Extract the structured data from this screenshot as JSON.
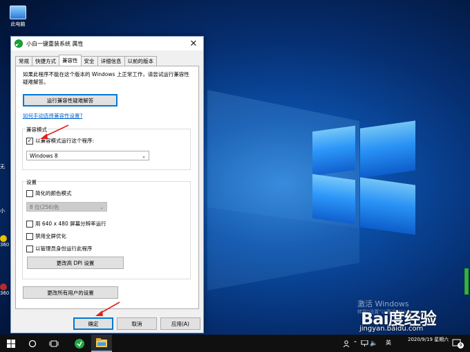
{
  "desktop": {
    "icons": [
      {
        "label": "此电脑"
      }
    ],
    "edge_labels": [
      "无",
      "小",
      "360",
      "360"
    ],
    "watermark": {
      "line1": "激活 Windows",
      "line2": "转到\"设置\"以激活 Windows。"
    },
    "baidu": {
      "logo": "Bai度经验",
      "url": "jingyan.baidu.com"
    }
  },
  "dialog": {
    "title": "小白一键重装系统 属性",
    "close_glyph": "✕",
    "tabs": [
      {
        "label": "常规"
      },
      {
        "label": "快捷方式"
      },
      {
        "label": "兼容性"
      },
      {
        "label": "安全"
      },
      {
        "label": "详细信息"
      },
      {
        "label": "以前的版本"
      }
    ],
    "active_tab": "兼容性",
    "info_text": "如果此程序不能在这个版本的 Windows 上正常工作，请尝试运行兼容性疑难解答。",
    "run_troubleshooter": "运行兼容性疑难解答",
    "manual_link": "如何手动选择兼容性设置?",
    "compat_mode": {
      "group_label": "兼容模式",
      "checkbox_label": "以兼容模式运行这个程序:",
      "checked": true,
      "selected_os": "Windows 8"
    },
    "settings": {
      "group_label": "设置",
      "reduced_color": {
        "label": "简化的颜色模式",
        "checked": false
      },
      "color_select": "8 位(256)色",
      "res_640": {
        "label": "用 640 x 480 屏幕分辨率运行",
        "checked": false
      },
      "disable_fullscreen": {
        "label": "禁用全屏优化",
        "checked": false
      },
      "run_as_admin": {
        "label": "以管理员身份运行此程序",
        "checked": false
      },
      "change_dpi": "更改高 DPI 设置"
    },
    "change_all_users": "更改所有用户的设置",
    "ok": "确定",
    "cancel": "取消",
    "apply": "应用(A)",
    "check_glyph": "✓"
  },
  "taskbar": {
    "ime": "英",
    "time": "",
    "date": "2020/9/19 星期六",
    "notification_count": "9"
  },
  "colors": {
    "accent": "#0078d7",
    "link": "#0066cc",
    "arrow": "#e02020"
  }
}
